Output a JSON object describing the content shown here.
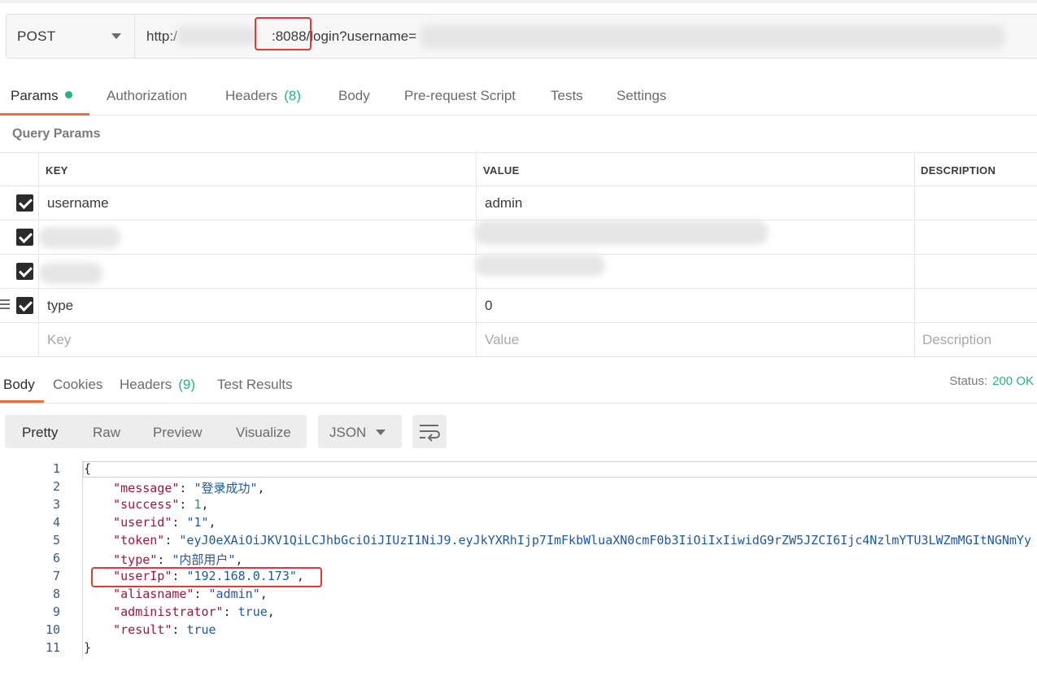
{
  "request": {
    "method": "POST",
    "url_prefix": "http:/",
    "url_port_path": ":8088/login?username="
  },
  "request_tabs": [
    {
      "label": "Params"
    },
    {
      "label": "Authorization"
    },
    {
      "label": "Headers",
      "count": "(8)"
    },
    {
      "label": "Body"
    },
    {
      "label": "Pre-request Script"
    },
    {
      "label": "Tests"
    },
    {
      "label": "Settings"
    }
  ],
  "query_params": {
    "title": "Query Params",
    "headers": {
      "key": "KEY",
      "value": "VALUE",
      "description": "DESCRIPTION"
    },
    "rows": [
      {
        "key": "username",
        "value": "admin",
        "checked": true
      },
      {
        "key": "",
        "value": "",
        "checked": true
      },
      {
        "key": "",
        "value": "",
        "checked": true
      },
      {
        "key": "type",
        "value": "0",
        "checked": true
      }
    ],
    "new_row": {
      "key_placeholder": "Key",
      "value_placeholder": "Value",
      "description_placeholder": "Description"
    }
  },
  "response_tabs": [
    {
      "label": "Body"
    },
    {
      "label": "Cookies"
    },
    {
      "label": "Headers",
      "count": "(9)"
    },
    {
      "label": "Test Results"
    }
  ],
  "status": {
    "label": "Status:",
    "value": "200 OK"
  },
  "view_modes": [
    "Pretty",
    "Raw",
    "Preview",
    "Visualize"
  ],
  "format": "JSON",
  "code": {
    "line_numbers": [
      "1",
      "2",
      "3",
      "4",
      "5",
      "6",
      "7",
      "8",
      "9",
      "10",
      "11"
    ],
    "open_brace": "{",
    "close_brace": "}",
    "lines": [
      {
        "key": "\"message\"",
        "value": "\"登录成功\"",
        "type": "s",
        "comma": ","
      },
      {
        "key": "\"success\"",
        "value": "1",
        "type": "n",
        "comma": ","
      },
      {
        "key": "\"userid\"",
        "value": "\"1\"",
        "type": "s",
        "comma": ","
      },
      {
        "key": "\"token\"",
        "value": "\"eyJ0eXAiOiJKV1QiLCJhbGciOiJIUzI1NiJ9.eyJkYXRhIjp7ImFkbWluaXN0cmF0b3IiOiIxIiwidG9rZW5JZCI6Ijc4NzlmYTU3LWZmMGItNGNmYy",
        "type": "s",
        "comma": ""
      },
      {
        "key": "\"type\"",
        "value": "\"内部用户\"",
        "type": "s",
        "comma": ","
      },
      {
        "key": "\"userIp\"",
        "value": "\"192.168.0.173\"",
        "type": "s",
        "comma": ","
      },
      {
        "key": "\"aliasname\"",
        "value": "\"admin\"",
        "type": "s",
        "comma": ","
      },
      {
        "key": "\"administrator\"",
        "value": "true",
        "type": "b",
        "comma": ","
      },
      {
        "key": "\"result\"",
        "value": "true",
        "type": "b",
        "comma": ""
      }
    ]
  },
  "colors": {
    "accent": "#f26b3a",
    "success": "#26b47f",
    "highlight": "#e53935"
  }
}
